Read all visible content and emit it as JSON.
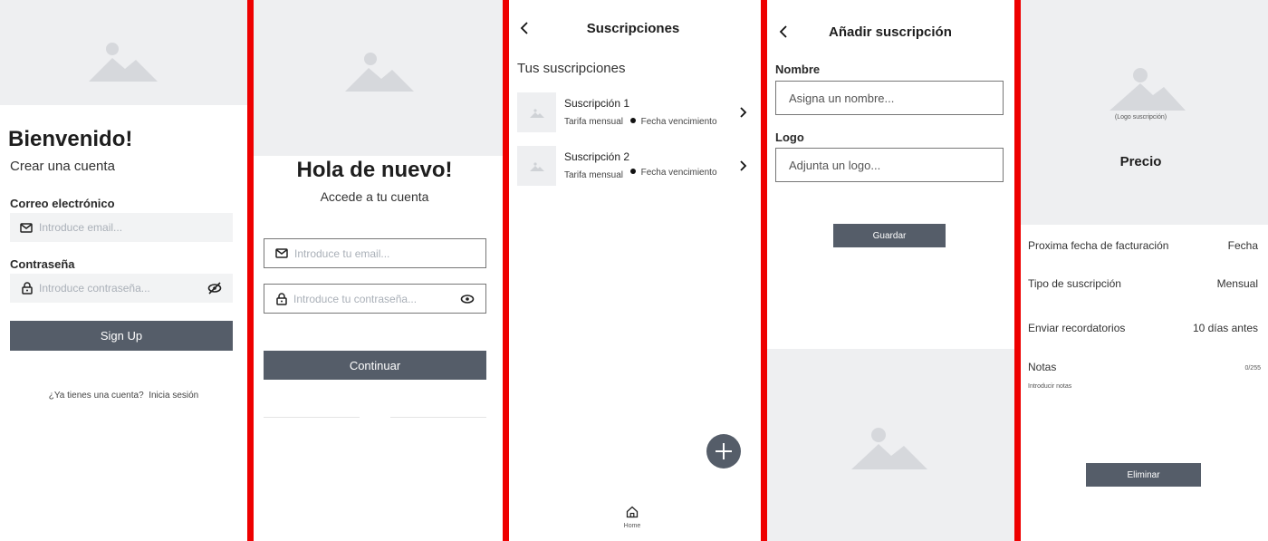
{
  "screen1": {
    "title": "Bienvenido!",
    "subtitle": "Crear una cuenta",
    "email_label": "Correo electrónico",
    "email_placeholder": "Introduce email...",
    "password_label": "Contraseña",
    "password_placeholder": "Introduce contraseña...",
    "signup_button": "Sign Up",
    "have_account": "¿Ya tienes una cuenta?",
    "login_link": "Inicia sesión"
  },
  "screen2": {
    "title": "Hola de nuevo!",
    "subtitle": "Accede a tu cuenta",
    "email_placeholder": "Introduce tu email...",
    "password_placeholder": "Introduce tu contraseña...",
    "continue_button": "Continuar"
  },
  "screen3": {
    "header_title": "Suscripciones",
    "section_title": "Tus suscripciones",
    "items": [
      {
        "name": "Suscripción 1",
        "plan": "Tarifa mensual",
        "due": "Fecha vencimiento"
      },
      {
        "name": "Suscripción 2",
        "plan": "Tarifa mensual",
        "due": "Fecha vencimiento"
      }
    ],
    "nav_home": "Home"
  },
  "screen4": {
    "header_title": "Añadir suscripción",
    "name_label": "Nombre",
    "name_placeholder": "Asigna un nombre...",
    "logo_label": "Logo",
    "logo_placeholder": "Adjunta un logo...",
    "save_button": "Guardar"
  },
  "screen5": {
    "logo_caption": "(Logo suscripción)",
    "price": "Precio",
    "rows": [
      {
        "label": "Proxima fecha de facturación",
        "value": "Fecha"
      },
      {
        "label": "Tipo de suscripción",
        "value": "Mensual"
      },
      {
        "label": "Enviar recordatorios",
        "value": "10 días antes"
      }
    ],
    "notes_label": "Notas",
    "notes_counter": "0/255",
    "notes_placeholder": "Introducir notas",
    "delete_button": "Eliminar"
  },
  "colors": {
    "divider": "#ee0000",
    "button": "#555d69",
    "placeholder_bg": "#eeeff1",
    "image_icon": "#d6d8dc"
  },
  "icons": [
    "image-placeholder-icon",
    "mail-icon",
    "lock-icon",
    "eye-off-icon",
    "eye-icon",
    "back-arrow-icon",
    "chevron-right-icon",
    "plus-icon",
    "home-icon"
  ]
}
